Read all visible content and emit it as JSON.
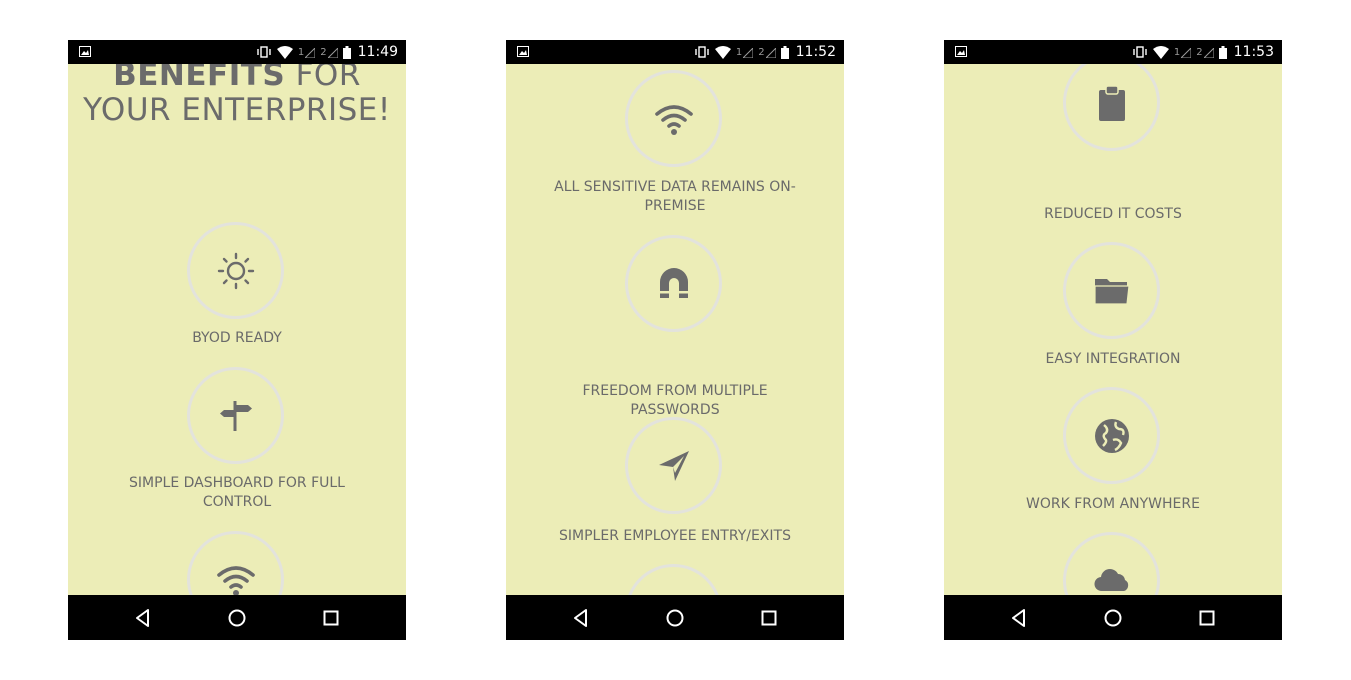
{
  "screens": [
    {
      "status": {
        "time": "11:49",
        "sim1": "1",
        "sim2": "2"
      },
      "heading": {
        "bold": "BENEFITS",
        "rest": " FOR YOUR ENTERPRISE!"
      },
      "features": [
        {
          "label": "BYOD READY",
          "icon": "sun-icon"
        },
        {
          "label": "SIMPLE DASHBOARD FOR FULL CONTROL",
          "icon": "signpost-icon"
        },
        {
          "label": "",
          "icon": "wifi-icon"
        }
      ]
    },
    {
      "status": {
        "time": "11:52",
        "sim1": "1",
        "sim2": "2"
      },
      "features": [
        {
          "label": "ALL SENSITIVE DATA REMAINS ON-PREMISE",
          "icon": "wifi-icon"
        },
        {
          "label": "FREEDOM FROM MULTIPLE PASSWORDS",
          "icon": "magnet-icon"
        },
        {
          "label": "SIMPLER EMPLOYEE ENTRY/EXITS",
          "icon": "navigation-arrow-icon"
        },
        {
          "label": "",
          "icon": "clipboard-icon"
        }
      ]
    },
    {
      "status": {
        "time": "11:53",
        "sim1": "1",
        "sim2": "2"
      },
      "features": [
        {
          "label": "REDUCED IT COSTS",
          "icon": "clipboard-icon"
        },
        {
          "label": "EASY INTEGRATION",
          "icon": "folder-icon"
        },
        {
          "label": "WORK FROM ANYWHERE",
          "icon": "globe-icon"
        },
        {
          "label": "",
          "icon": "cloud-icon"
        }
      ]
    }
  ],
  "colors": {
    "background": "#ecedb7",
    "text": "#6b6b6b",
    "circle_border": "#e3e3dc",
    "bars": "#000000"
  }
}
